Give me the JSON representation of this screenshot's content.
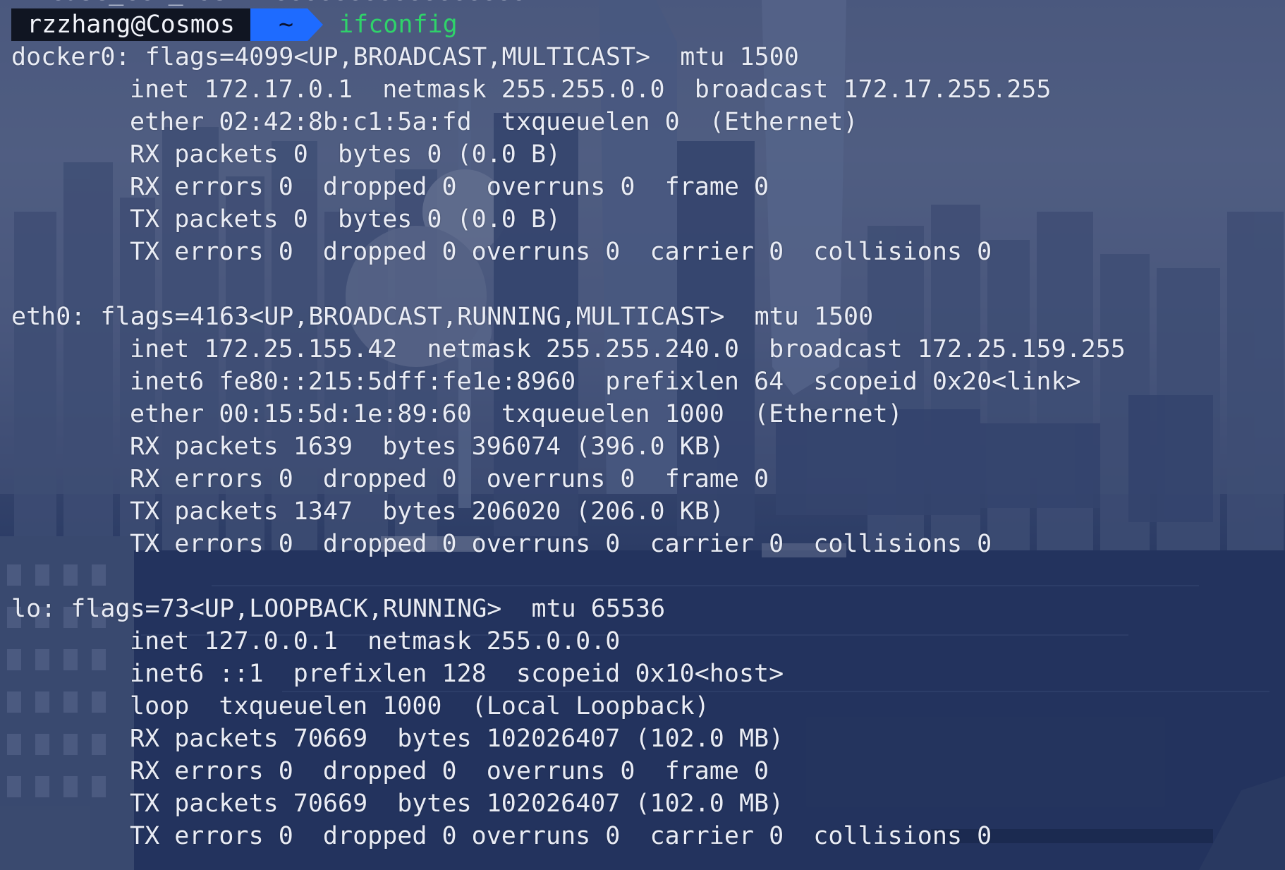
{
  "terminal": {
    "previous_line_fragment": "cuse_ccn_mask  ccccccccccccccccc",
    "prompt": {
      "user_host": "rzzhang@Cosmos",
      "directory": "~",
      "command": "ifconfig"
    },
    "colors": {
      "prompt_user_bg": "#101522",
      "prompt_dir_bg": "#1e6bff",
      "command_text": "#2fd36a",
      "output_text": "#e9ecf5"
    },
    "interfaces": [
      {
        "header": "docker0: flags=4099<UP,BROADCAST,MULTICAST>  mtu 1500",
        "details": [
          "inet 172.17.0.1  netmask 255.255.0.0  broadcast 172.17.255.255",
          "ether 02:42:8b:c1:5a:fd  txqueuelen 0  (Ethernet)",
          "RX packets 0  bytes 0 (0.0 B)",
          "RX errors 0  dropped 0  overruns 0  frame 0",
          "TX packets 0  bytes 0 (0.0 B)",
          "TX errors 0  dropped 0 overruns 0  carrier 0  collisions 0"
        ]
      },
      {
        "header": "eth0: flags=4163<UP,BROADCAST,RUNNING,MULTICAST>  mtu 1500",
        "details": [
          "inet 172.25.155.42  netmask 255.255.240.0  broadcast 172.25.159.255",
          "inet6 fe80::215:5dff:fe1e:8960  prefixlen 64  scopeid 0x20<link>",
          "ether 00:15:5d:1e:89:60  txqueuelen 1000  (Ethernet)",
          "RX packets 1639  bytes 396074 (396.0 KB)",
          "RX errors 0  dropped 0  overruns 0  frame 0",
          "TX packets 1347  bytes 206020 (206.0 KB)",
          "TX errors 0  dropped 0 overruns 0  carrier 0  collisions 0"
        ]
      },
      {
        "header": "lo: flags=73<UP,LOOPBACK,RUNNING>  mtu 65536",
        "details": [
          "inet 127.0.0.1  netmask 255.0.0.0",
          "inet6 ::1  prefixlen 128  scopeid 0x10<host>",
          "loop  txqueuelen 1000  (Local Loopback)",
          "RX packets 70669  bytes 102026407 (102.0 MB)",
          "RX errors 0  dropped 0  overruns 0  frame 0",
          "TX packets 70669  bytes 102026407 (102.0 MB)",
          "TX errors 0  dropped 0 overruns 0  carrier 0  collisions 0"
        ]
      }
    ]
  }
}
